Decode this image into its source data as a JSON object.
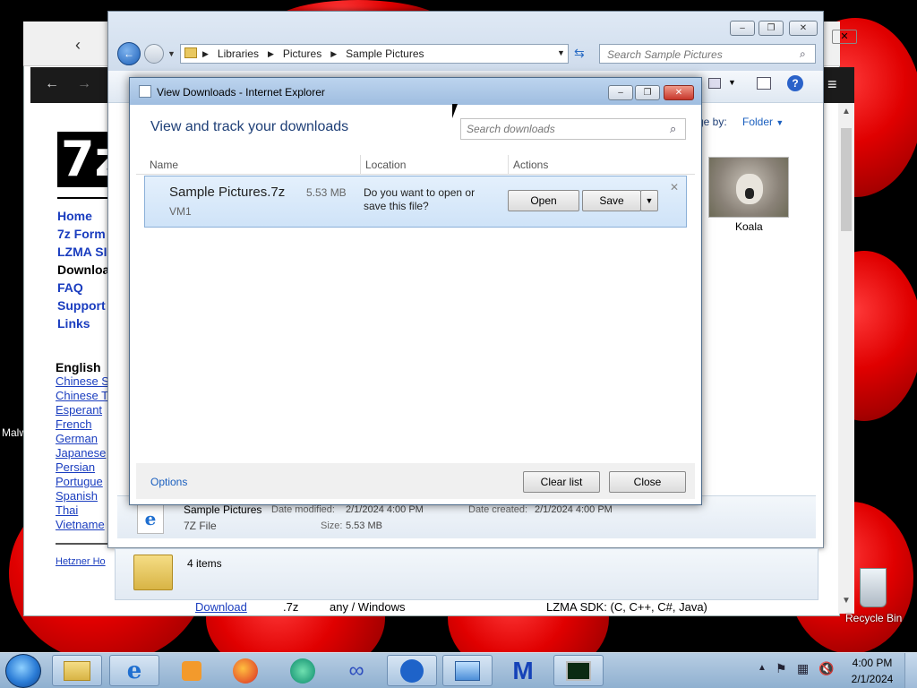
{
  "browser": {
    "nav_links": [
      "Home",
      "7z Form",
      "LZMA SI",
      "Downloa",
      "FAQ",
      "Support",
      "Links"
    ],
    "lang_heading": "English",
    "lang_links": [
      "Chinese S",
      "Chinese T",
      "Esperant",
      "French",
      "German",
      "Japanese",
      "Persian",
      "Portugue",
      "Spanish",
      "Thai",
      "Vietname"
    ],
    "footer_link": "Hetzner Ho",
    "bottom_row": [
      "Download",
      ".7z",
      "any / Windows",
      "LZMA SDK: (C, C++, C#, Java)"
    ],
    "logo_text": "7z"
  },
  "explorer": {
    "breadcrumbs": [
      "Libraries",
      "Pictures",
      "Sample Pictures"
    ],
    "search_placeholder": "Search Sample Pictures",
    "arrange_label": "ge by:",
    "arrange_value": "Folder",
    "thumb_label": "Koala",
    "details": {
      "name": "Sample Pictures",
      "type": "7Z File",
      "modified_label": "Date modified:",
      "modified_value": "2/1/2024 4:00 PM",
      "created_label": "Date created:",
      "created_value": "2/1/2024 4:00 PM",
      "size_label": "Size:",
      "size_value": "5.53 MB"
    },
    "status": "4 items"
  },
  "downloads_dialog": {
    "title": "View Downloads - Internet Explorer",
    "heading": "View and track your downloads",
    "search_placeholder": "Search downloads",
    "columns": [
      "Name",
      "Location",
      "Actions"
    ],
    "item": {
      "file_name": "Sample Pictures.7z",
      "size": "5.53 MB",
      "source": "VM1",
      "prompt": "Do you want to open or save this file?",
      "open_label": "Open",
      "save_label": "Save"
    },
    "options_label": "Options",
    "clear_label": "Clear list",
    "close_label": "Close"
  },
  "desktop": {
    "recycle_bin_label": "Recycle Bin",
    "left_label": "Malw"
  },
  "taskbar": {
    "time": "4:00 PM",
    "date": "2/1/2024"
  },
  "colors": {
    "accent": "#1a3dbf",
    "dialog_heading": "#1e3f77"
  }
}
